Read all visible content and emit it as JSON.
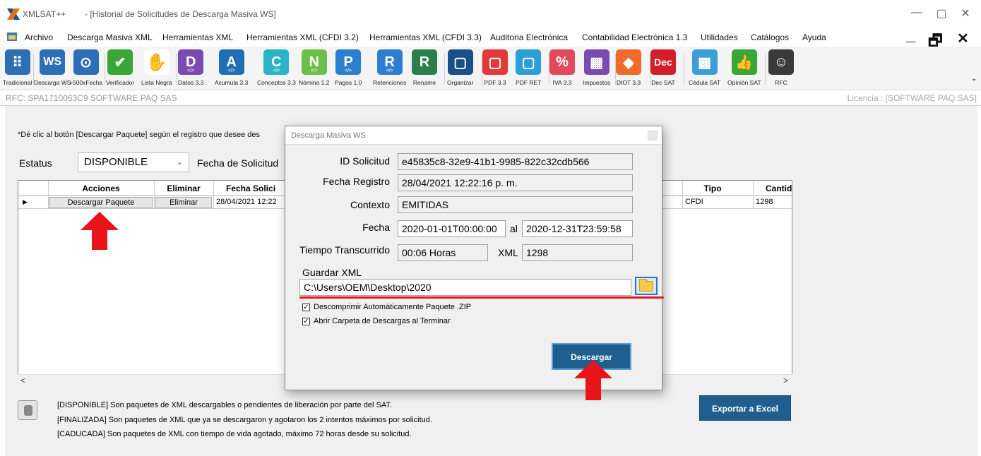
{
  "window": {
    "app_title": "XMLSAT++",
    "doc_title": "- [Historial de Solicitudes de Descarga Masiva WS]",
    "minimize": "—",
    "maximize": "▢",
    "close": "✕"
  },
  "menu": {
    "items": [
      "Archivo",
      "Descarga Masiva XML",
      "Herramientas XML",
      "Herramientas XML (CFDI 3.2)",
      "Herramientas XML (CFDI 3.3)",
      "Auditoria Electrónica",
      "Contabilidad Electrónica 1.3",
      "Utilidades",
      "Catálogos",
      "Ayuda"
    ],
    "mdi_min": "_",
    "mdi_restore": "🗗",
    "mdi_close": "✕"
  },
  "toolbar": {
    "items": [
      {
        "label": "Tradicional",
        "glyph": "⠿",
        "color": "#2d6fb5"
      },
      {
        "label": "Descarga WS",
        "glyph": "WS",
        "color": "#2d6fb5"
      },
      {
        "label": "+500xFecha",
        "glyph": "⊙",
        "color": "#2d6fb5"
      },
      {
        "label": "Verificador",
        "glyph": "✔",
        "color": "#3aa635"
      },
      {
        "label": "Lista Negra",
        "glyph": "✋",
        "color": "#ffffff"
      },
      {
        "label": "Datos 3.3",
        "glyph": "D",
        "color": "#7a4bb0"
      },
      {
        "label": "Acumula 3.3",
        "glyph": "A",
        "color": "#1f6fb5"
      },
      {
        "label": "Conceptos 3.3",
        "glyph": "C",
        "color": "#2bb3c6"
      },
      {
        "label": "Nómina 1.2",
        "glyph": "N",
        "color": "#6cc04a"
      },
      {
        "label": "Pagos 1.0",
        "glyph": "P",
        "color": "#2c7fd0"
      },
      {
        "label": "Retenciones",
        "glyph": "R",
        "color": "#2c7fd0"
      },
      {
        "label": "Rename",
        "glyph": "R",
        "color": "#2e7d4f"
      },
      {
        "label": "Organizar",
        "glyph": "▢",
        "color": "#1b4f8a"
      },
      {
        "label": "PDF 3.3",
        "glyph": "▢",
        "color": "#e03a3a"
      },
      {
        "label": "PDF RET",
        "glyph": "▢",
        "color": "#2c9fd6"
      },
      {
        "label": "IVA 3.3",
        "glyph": "%",
        "color": "#e04a5a"
      },
      {
        "label": "Impuestos",
        "glyph": "▦",
        "color": "#7a4bb0"
      },
      {
        "label": "DIOT 3.3",
        "glyph": "◆",
        "color": "#f06a2a"
      },
      {
        "label": "Dec SAT",
        "glyph": "Dec",
        "color": "#d41f2a"
      },
      {
        "label": "Cédula SAT",
        "glyph": "▩",
        "color": "#3d9fd8"
      },
      {
        "label": "Opinión SAT",
        "glyph": "👍",
        "color": "#3aa635"
      },
      {
        "label": "RFC",
        "glyph": "☺",
        "color": "#3a3a3a"
      }
    ],
    "overflow": "⌄"
  },
  "statusbar": {
    "rfc": "RFC: SPA1710063C9 SOFTWARE PAQ SAS",
    "license": "Licencia : [SOFTWARE PAQ SAS]"
  },
  "main": {
    "instruction": "*Dé clic al botón [Descargar Paquete] según el registro que desee des",
    "estatus_label": "Estatus",
    "estatus_value": "DISPONIBLE",
    "fecha_label": "Fecha de Solicitud",
    "columns": {
      "acciones": "Acciones",
      "eliminar": "Eliminar",
      "fecha": "Fecha Solici",
      "tipo": "Tipo",
      "cantidad": "Cantid"
    },
    "row": {
      "selector": "▶",
      "descargar": "Descargar Paquete",
      "eliminar": "Eliminar",
      "fecha": "28/04/2021 12:22",
      "tipo": "CFDI",
      "cantidad": "1298"
    },
    "scroll_left": "<",
    "scroll_right": ">",
    "legend": [
      "[DISPONIBLE] Son paquetes de XML descargables o pendientes de liberación por parte del SAT.",
      "[FINALIZADA]  Son paquetes de XML que ya se descargaron y agotaron los 2 intentos máximos por solicitud.",
      "[CADUCADA]  Son paquetes de XML con tiempo de vida agotado, máximo 72 horas desde su solicitud."
    ],
    "export_label": "Exportar  a Excel"
  },
  "dialog": {
    "title": "Descarga Masiva WS",
    "id_label": "ID Solicitud",
    "id_value": "e45835c8-32e9-41b1-9985-822c32cdb566",
    "registro_label": "Fecha Registro",
    "registro_value": "28/04/2021 12:22:16 p. m.",
    "contexto_label": "Contexto",
    "contexto_value": "EMITIDAS",
    "fecha_label": "Fecha",
    "fecha_desde": "2020-01-01T00:00:00",
    "al_label": "al",
    "fecha_hasta": "2020-12-31T23:59:58",
    "tiempo_label": "Tiempo Transcurrido",
    "tiempo_value": "00:06 Horas",
    "xml_label": "XML",
    "xml_value": "1298",
    "guardar_label": "Guardar XML",
    "ruta_value": "C:\\Users\\OEM\\Desktop\\2020",
    "check1": "Descomprimir Automáticamente Paquete .ZIP",
    "check2": "Abrir Carpeta de Descargas al Terminar",
    "check_mark": "✓",
    "descargar_label": "Descargar"
  },
  "colors": {
    "accent": "#1f5f8f",
    "annotation": "#e8141a"
  }
}
